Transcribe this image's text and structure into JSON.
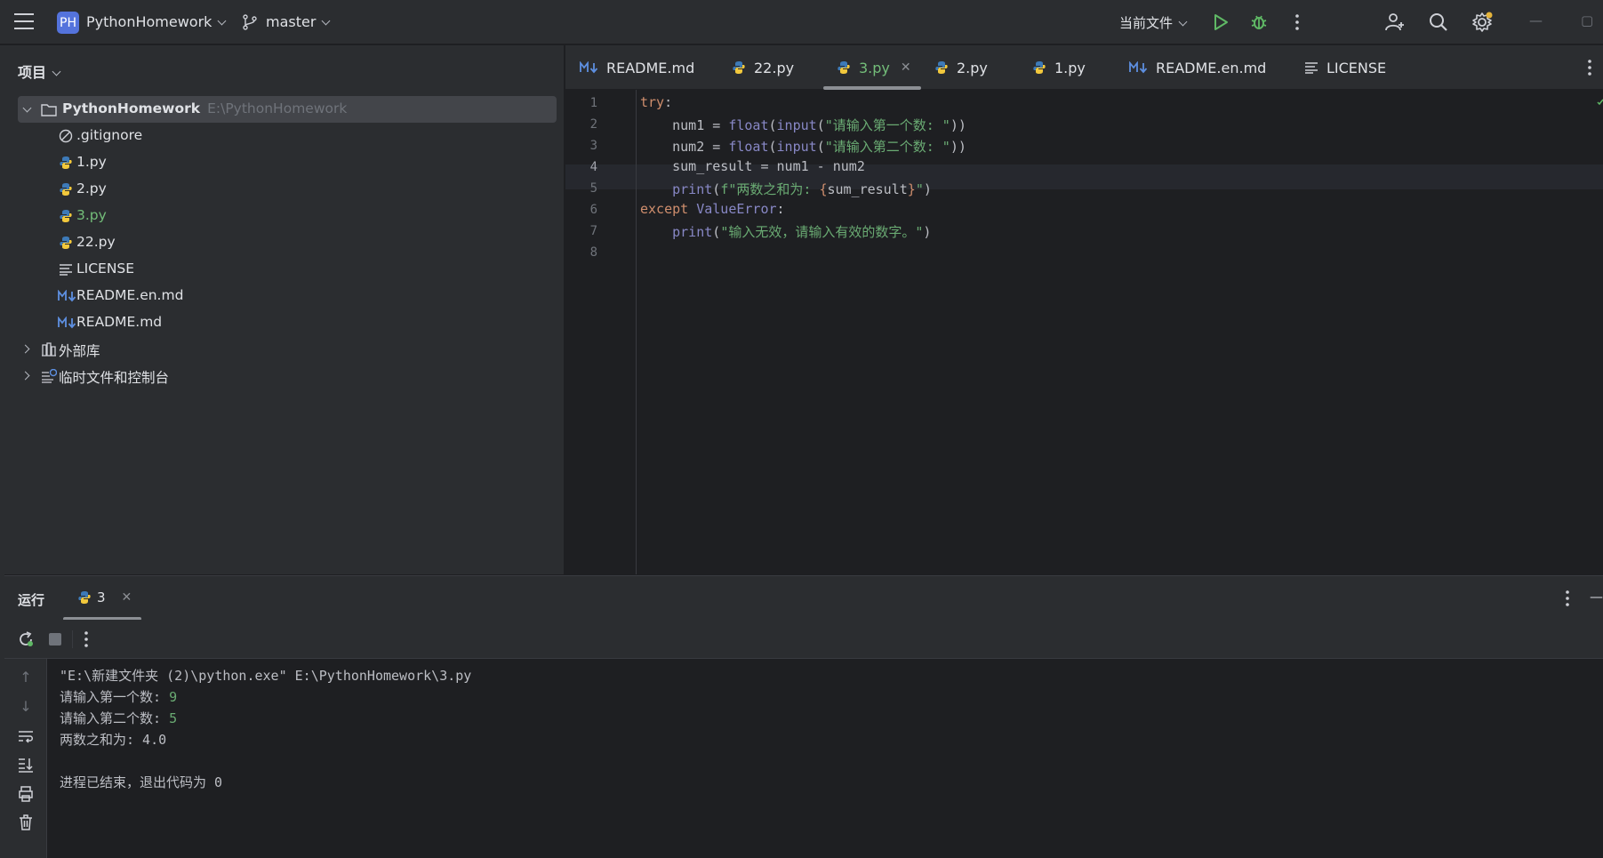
{
  "titlebar": {
    "project_badge": "PH",
    "project_name": "PythonHomework",
    "branch": "master",
    "run_config": "当前文件",
    "icons": [
      "main-menu-icon",
      "branch-icon",
      "run-icon",
      "debug-icon",
      "more-icon",
      "add-user-icon",
      "search-icon",
      "settings-icon"
    ],
    "accent": "#5473dc",
    "run_color": "#5fb865"
  },
  "project": {
    "title": "项目",
    "root": {
      "name": "PythonHomework",
      "path": "E:\\PythonHomework"
    },
    "files": [
      {
        "name": ".gitignore",
        "icon": "ignore-icon"
      },
      {
        "name": "1.py",
        "icon": "python-icon"
      },
      {
        "name": "2.py",
        "icon": "python-icon"
      },
      {
        "name": "3.py",
        "icon": "python-icon",
        "modified": true
      },
      {
        "name": "22.py",
        "icon": "python-icon"
      },
      {
        "name": "LICENSE",
        "icon": "text-icon"
      },
      {
        "name": "README.en.md",
        "icon": "markdown-icon"
      },
      {
        "name": "README.md",
        "icon": "markdown-icon"
      }
    ],
    "external_libs": "外部库",
    "scratches": "临时文件和控制台"
  },
  "editor": {
    "tabs": [
      {
        "label": "README.md",
        "icon": "markdown-icon"
      },
      {
        "label": "22.py",
        "icon": "python-icon"
      },
      {
        "label": "3.py",
        "icon": "python-icon",
        "active": true
      },
      {
        "label": "2.py",
        "icon": "python-icon"
      },
      {
        "label": "1.py",
        "icon": "python-icon"
      },
      {
        "label": "README.en.md",
        "icon": "markdown-icon"
      },
      {
        "label": "LICENSE",
        "icon": "text-icon"
      }
    ],
    "line_numbers": [
      "1",
      "2",
      "3",
      "4",
      "5",
      "6",
      "7",
      "8"
    ],
    "current_line": "4",
    "code": {
      "l1_kw": "try",
      "l1_colon": ":",
      "l2_var": "    num1 = ",
      "l2_float": "float",
      "l2_p1": "(",
      "l2_input": "input",
      "l2_p2": "(",
      "l2_str": "\"请输入第一个数: \"",
      "l2_close": "))",
      "l3_var": "    num2 = ",
      "l3_float": "float",
      "l3_p1": "(",
      "l3_input": "input",
      "l3_p2": "(",
      "l3_str": "\"请输入第二个数: \"",
      "l3_close": "))",
      "l4": "    sum_result = num1 - num2",
      "l5_indent": "    ",
      "l5_print": "print",
      "l5_p": "(",
      "l5_str1": "f\"两数之和为: ",
      "l5_brace1": "{",
      "l5_var": "sum_result",
      "l5_brace2": "}",
      "l5_str2": "\"",
      "l5_close": ")",
      "l6_kw": "except ",
      "l6_cls": "ValueError",
      "l6_colon": ":",
      "l7_indent": "    ",
      "l7_print": "print",
      "l7_p": "(",
      "l7_str": "\"输入无效，请输入有效的数字。\"",
      "l7_close": ")"
    }
  },
  "run": {
    "title": "运行",
    "tab_label": "3",
    "console": {
      "cmd": "\"E:\\新建文件夹 (2)\\python.exe\" E:\\PythonHomework\\3.py",
      "prompt1": "请输入第一个数: ",
      "input1": "9",
      "prompt2": "请输入第二个数: ",
      "input2": "5",
      "result": "两数之和为: 4.0",
      "exit": "进程已结束，退出代码为 0"
    }
  }
}
